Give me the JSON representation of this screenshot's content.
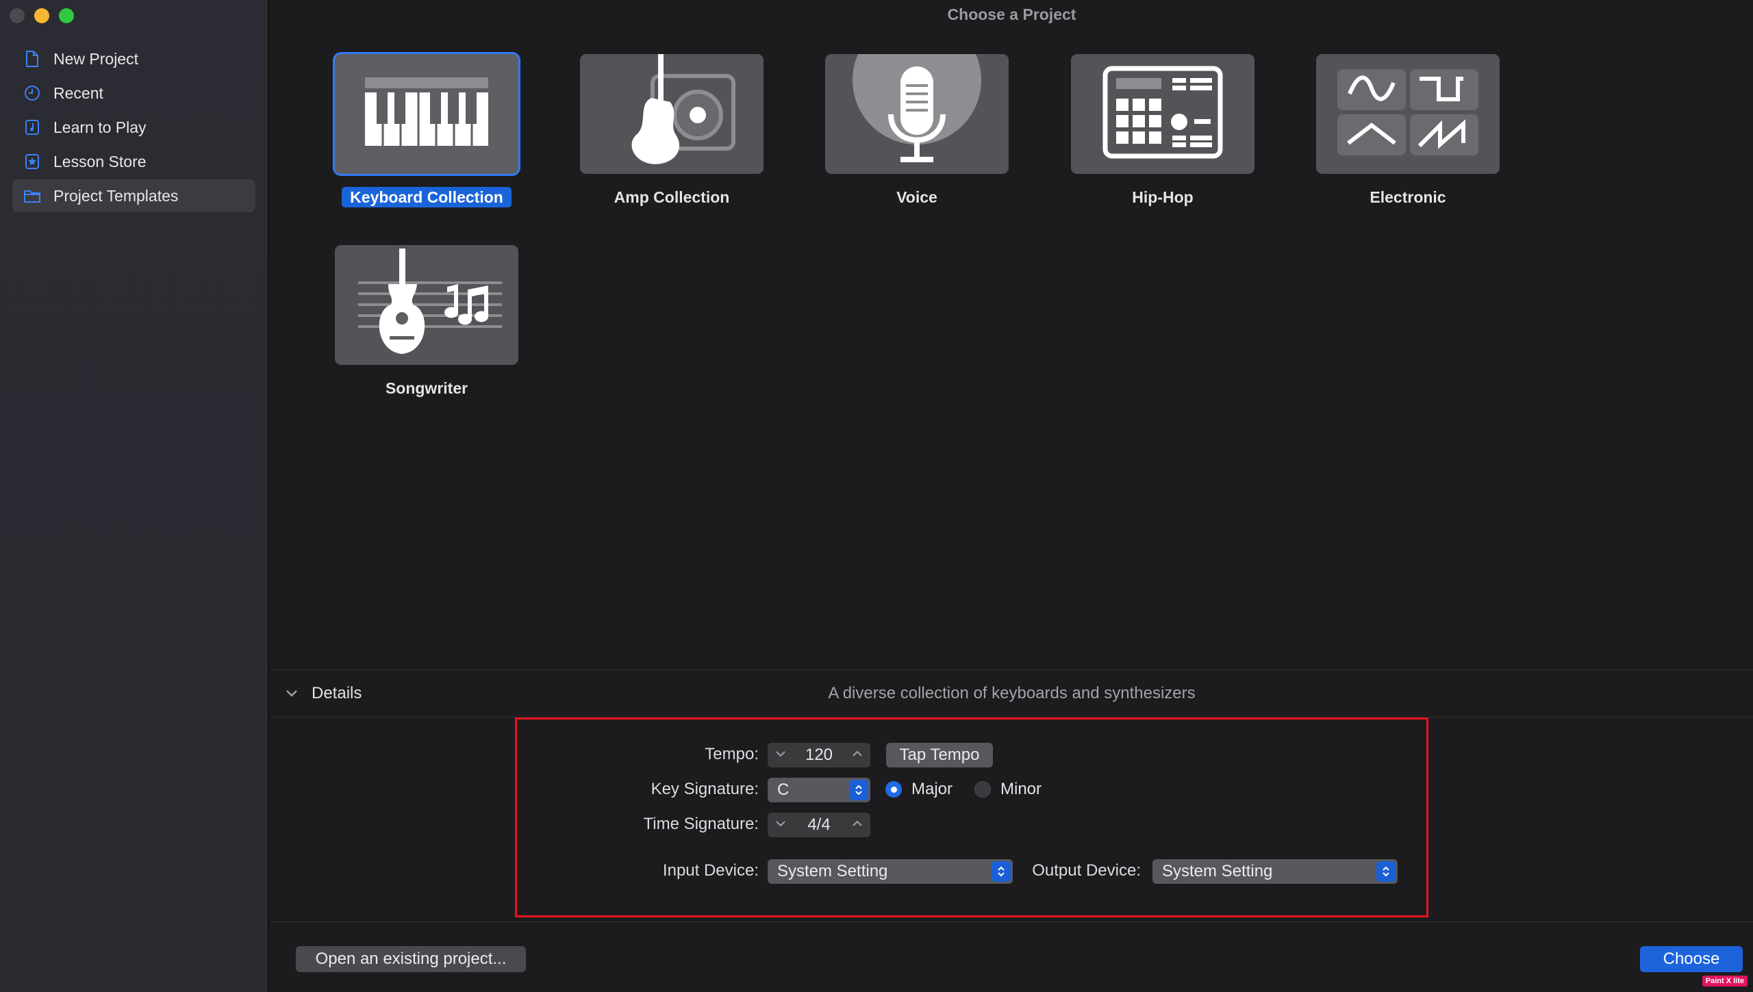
{
  "window": {
    "title": "Choose a Project"
  },
  "sidebar": {
    "items": [
      {
        "label": "New Project",
        "icon": "document-icon"
      },
      {
        "label": "Recent",
        "icon": "clock-icon"
      },
      {
        "label": "Learn to Play",
        "icon": "music-note-icon"
      },
      {
        "label": "Lesson Store",
        "icon": "star-icon"
      },
      {
        "label": "Project Templates",
        "icon": "folder-icon",
        "selected": true
      }
    ]
  },
  "templates": [
    {
      "label": "Keyboard Collection",
      "icon": "keyboard-icon",
      "selected": true
    },
    {
      "label": "Amp Collection",
      "icon": "guitar-amp-icon"
    },
    {
      "label": "Voice",
      "icon": "microphone-icon"
    },
    {
      "label": "Hip-Hop",
      "icon": "drum-machine-icon"
    },
    {
      "label": "Electronic",
      "icon": "waveforms-icon"
    },
    {
      "label": "Songwriter",
      "icon": "acoustic-guitar-icon"
    }
  ],
  "details": {
    "label": "Details",
    "description": "A diverse collection of keyboards and synthesizers",
    "tempo_label": "Tempo:",
    "tempo_value": "120",
    "tap_tempo": "Tap Tempo",
    "key_label": "Key Signature:",
    "key_value": "C",
    "major": "Major",
    "minor": "Minor",
    "mode_selected": "Major",
    "time_label": "Time Signature:",
    "time_value": "4/4",
    "input_label": "Input Device:",
    "input_value": "System Setting",
    "output_label": "Output Device:",
    "output_value": "System Setting"
  },
  "footer": {
    "open_existing": "Open an existing project...",
    "choose": "Choose"
  },
  "watermark": "Paint X lite",
  "colors": {
    "accent": "#1c63dc",
    "highlight": "#e6121b",
    "background": "#1c1c1e"
  }
}
